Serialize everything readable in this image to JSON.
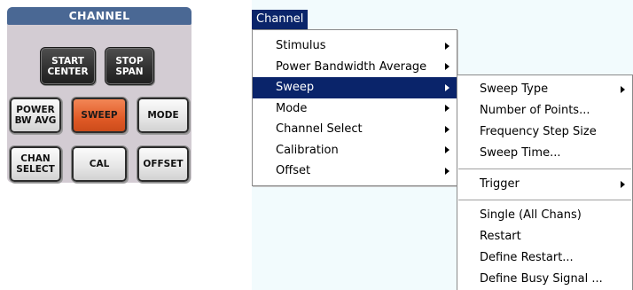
{
  "panel": {
    "title": "CHANNEL",
    "keys": {
      "start_center": "START\nCENTER",
      "stop_span": "STOP\nSPAN",
      "power_bw_avg": "POWER\nBW AVG",
      "sweep": "SWEEP",
      "mode": "MODE",
      "chan_select": "CHAN\nSELECT",
      "cal": "CAL",
      "offset": "OFFSET"
    },
    "active_key_color": "#e05a26",
    "dark_key_color": "#2f2f2f"
  },
  "menubar": {
    "channel": "Channel"
  },
  "menu": {
    "items": [
      {
        "label": "Stimulus",
        "submenu": true
      },
      {
        "label": "Power Bandwidth Average",
        "submenu": true
      },
      {
        "label": "Sweep",
        "submenu": true,
        "selected": true
      },
      {
        "label": "Mode",
        "submenu": true
      },
      {
        "label": "Channel Select",
        "submenu": true
      },
      {
        "label": "Calibration",
        "submenu": true
      },
      {
        "label": "Offset",
        "submenu": true
      }
    ]
  },
  "submenu": {
    "sweep_type": "Sweep Type",
    "number_of_points": "Number of Points...",
    "frequency_step_size": "Frequency Step Size",
    "sweep_time": "Sweep Time...",
    "trigger": "Trigger",
    "single_all_chans": "Single (All Chans)",
    "restart": "Restart",
    "define_restart": "Define Restart...",
    "define_busy_signal": "Define Busy Signal ..."
  },
  "colors": {
    "highlight": "#0a246a",
    "panel_header": "#4a6894",
    "screen_background": "#f2fbfd"
  }
}
